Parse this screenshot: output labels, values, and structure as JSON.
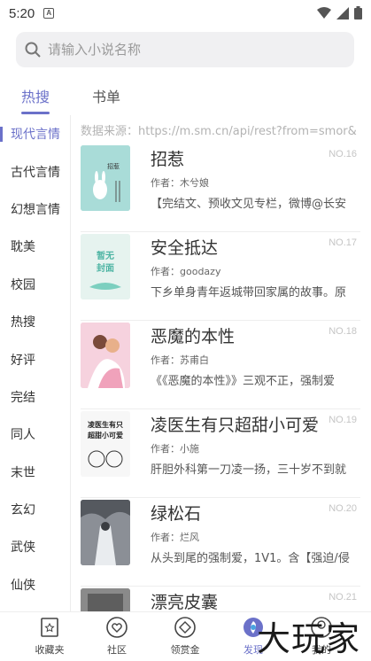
{
  "status": {
    "time": "5:20",
    "notif_glyph": "A"
  },
  "search": {
    "placeholder": "请输入小说名称"
  },
  "tabs": [
    {
      "label": "热搜",
      "active": true
    },
    {
      "label": "书单",
      "active": false
    }
  ],
  "sidebar": {
    "items": [
      {
        "label": "现代言情",
        "active": true
      },
      {
        "label": "古代言情"
      },
      {
        "label": "幻想言情"
      },
      {
        "label": "耽美"
      },
      {
        "label": "校园"
      },
      {
        "label": "热搜"
      },
      {
        "label": "好评"
      },
      {
        "label": "完结"
      },
      {
        "label": "同人"
      },
      {
        "label": "末世"
      },
      {
        "label": "玄幻"
      },
      {
        "label": "武侠"
      },
      {
        "label": "仙侠"
      }
    ]
  },
  "main": {
    "source": "数据来源：https://m.sm.cn/api/rest?from=smor&",
    "books": [
      {
        "title": "招惹",
        "no": "NO.16",
        "author": "作者：木兮娘",
        "desc": "【完结文、预收文见专栏，微博@长安",
        "cover_text": "招惹",
        "cover_color": "#a9dcd8"
      },
      {
        "title": "安全抵达",
        "no": "NO.17",
        "author": "作者：goodazy",
        "desc": "下乡单身青年返城带回家属的故事。原",
        "cover_text": "暂无封面",
        "cover_color": "#e6f3ef"
      },
      {
        "title": "恶魔的本性",
        "no": "NO.18",
        "author": "作者：苏甫白",
        "desc": "《《恶魔的本性》》三观不正，强制爱",
        "cover_text": "",
        "cover_color": "#f3c6d6"
      },
      {
        "title": "凌医生有只超甜小可爱",
        "no": "NO.19",
        "author": "作者：小施",
        "desc": "肝胆外科第一刀凌一扬，三十岁不到就",
        "cover_text": "凌医生有只超甜小可爱",
        "cover_color": "#f4f4f4"
      },
      {
        "title": "绿松石",
        "no": "NO.20",
        "author": "作者：烂风",
        "desc": "从头到尾的强制爱，1V1。含【强迫/侵",
        "cover_text": "",
        "cover_color": "#7c8088"
      },
      {
        "title": "漂亮皮囊",
        "no": "NO.21",
        "author": "",
        "desc": "",
        "cover_text": "",
        "cover_color": "#8a8a8a"
      }
    ]
  },
  "nav": [
    {
      "label": "收藏夹",
      "icon": "bookmark-icon"
    },
    {
      "label": "社区",
      "icon": "heart-chat-icon"
    },
    {
      "label": "领赏金",
      "icon": "diamond-icon"
    },
    {
      "label": "发现",
      "icon": "discover-icon",
      "active": true
    },
    {
      "label": "我的",
      "icon": "user-icon"
    }
  ],
  "watermark": "大玩家",
  "colors": {
    "accent": "#6b71c9"
  }
}
